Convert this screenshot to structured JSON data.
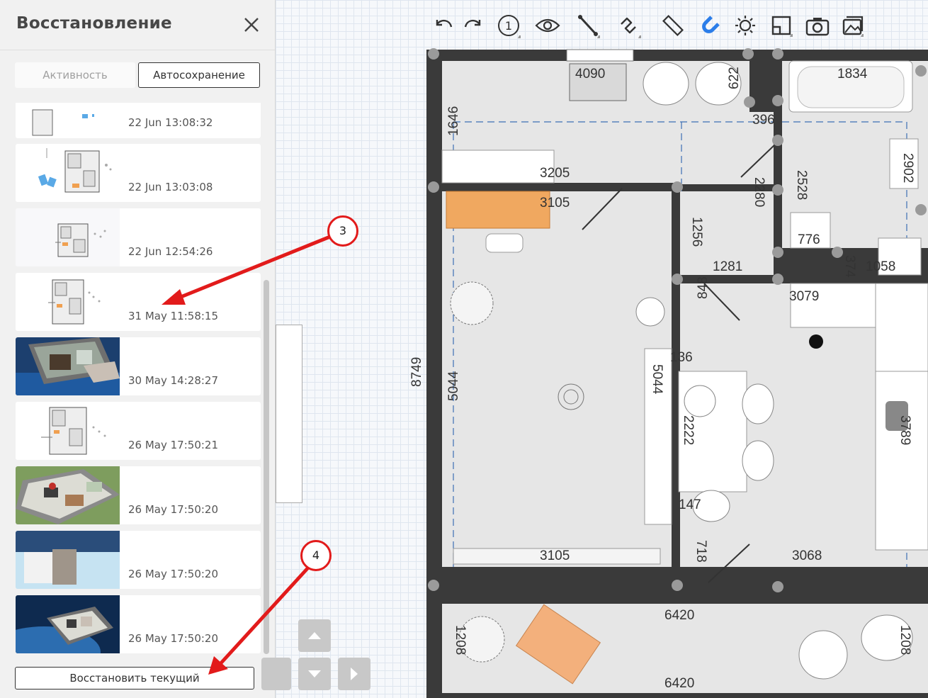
{
  "panel": {
    "title": "Восстановление",
    "tabs": [
      {
        "label": "Активность",
        "active": false
      },
      {
        "label": "Автосохранение",
        "active": true
      }
    ],
    "items": [
      {
        "time": "22 Jun 13:08:32",
        "thumb": "plan"
      },
      {
        "time": "22 Jun 13:03:08",
        "thumb": "plan"
      },
      {
        "time": "22 Jun 12:54:26",
        "thumb": "plan"
      },
      {
        "time": "31 May 11:58:15",
        "thumb": "plan"
      },
      {
        "time": "30 May 14:28:27",
        "thumb": "3d"
      },
      {
        "time": "26 May 17:50:21",
        "thumb": "plan"
      },
      {
        "time": "26 May 17:50:20",
        "thumb": "3d"
      },
      {
        "time": "26 May 17:50:20",
        "thumb": "3d-box"
      },
      {
        "time": "26 May 17:50:20",
        "thumb": "3d-space"
      }
    ],
    "restore_label": "Восстановить текущий"
  },
  "toolbar": {
    "icons": [
      "undo-icon",
      "redo-icon",
      "floor-number-icon",
      "eye-icon",
      "wall-tool-icon",
      "curve-tool-icon",
      "ruler-icon",
      "magnet-icon",
      "light-icon",
      "floorplan-icon",
      "camera-icon",
      "gallery-icon"
    ],
    "floor_number": "1",
    "active_color": "#2b7de9"
  },
  "annotations": [
    {
      "label": "3",
      "color": "#e21b1b"
    },
    {
      "label": "4",
      "color": "#e21b1b"
    }
  ],
  "plan": {
    "dims": [
      "4090",
      "622",
      "1834",
      "396",
      "1646",
      "3205",
      "2528",
      "2902",
      "2280",
      "3105",
      "1256",
      "776",
      "1281",
      "374",
      "1058",
      "3079",
      "848",
      "8749",
      "5044",
      "5044",
      "136",
      "3789",
      "2222",
      "147",
      "718",
      "3105",
      "3068",
      "6420",
      "1208",
      "1208",
      "6420"
    ]
  }
}
